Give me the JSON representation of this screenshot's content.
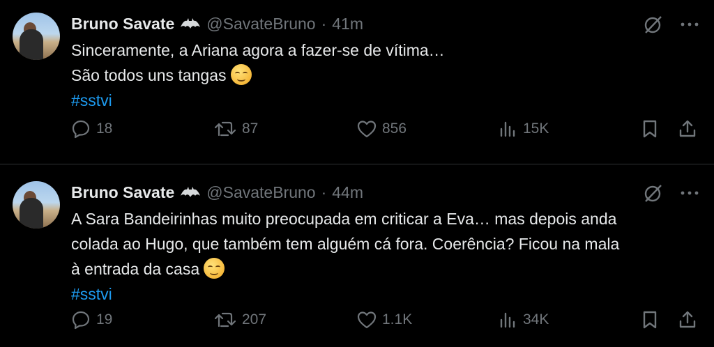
{
  "tweets": [
    {
      "name": "Bruno Savate",
      "handle": "@SavateBruno",
      "separator": "·",
      "time": "41m",
      "lines": [
        "Sinceramente, a Ariana agora a fazer-se de vítima…",
        "São todos uns tangas"
      ],
      "hashtag": "#sstvi",
      "replies": "18",
      "retweets": "87",
      "likes": "856",
      "views": "15K"
    },
    {
      "name": "Bruno Savate",
      "handle": "@SavateBruno",
      "separator": "·",
      "time": "44m",
      "lines": [
        "A Sara Bandeirinhas muito preocupada em criticar a Eva… mas depois anda",
        "colada ao Hugo, que também tem alguém cá fora. Coerência? Ficou na mala",
        "à entrada da casa"
      ],
      "hashtag": "#sstvi",
      "replies": "19",
      "retweets": "207",
      "likes": "1.1K",
      "views": "34K"
    }
  ],
  "icons": {
    "reply": "reply-icon",
    "retweet": "retweet-icon",
    "like": "heart-icon",
    "views": "views-icon",
    "bookmark": "bookmark-icon",
    "share": "share-icon",
    "grok": "grok-icon",
    "more": "more-icon",
    "badge": "batman-badge-icon"
  },
  "colors": {
    "background": "#000000",
    "text": "#e7e9ea",
    "muted": "#71767b",
    "link": "#1d9bf0",
    "divider": "#2f3336"
  }
}
